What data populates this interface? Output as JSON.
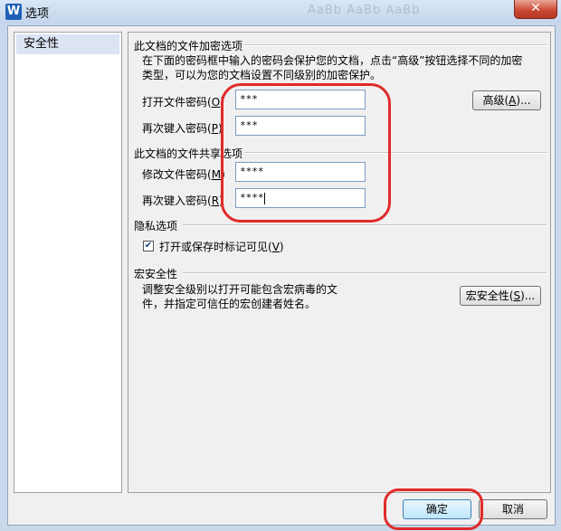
{
  "window": {
    "title": "选项",
    "app_icon": "W",
    "close_glyph": "✕",
    "background_ghost": "AaBb AaBb AaBb"
  },
  "sidebar": {
    "items": [
      {
        "label": "安全性"
      }
    ]
  },
  "encryption": {
    "title": "此文档的文件加密选项",
    "desc_line1": "在下面的密码框中输入的密码会保护您的文档，点击“高级”按钮选择不同的加密",
    "desc_line2": "类型，可以为您的文档设置不同级别的加密保护。",
    "open_pw_label": "打开文件密码",
    "open_pw_key": "O",
    "open_pw_value": "***",
    "confirm_pw_label": "再次键入密码",
    "confirm_pw_key": "P",
    "confirm_pw_value": "***",
    "advanced_label": "高级",
    "advanced_key": "A"
  },
  "sharing": {
    "title": "此文档的文件共享选项",
    "modify_pw_label": "修改文件密码",
    "modify_pw_key": "M",
    "modify_pw_value": "****",
    "confirm_pw_label": "再次键入密码",
    "confirm_pw_key": "R",
    "confirm_pw_value": "****"
  },
  "privacy": {
    "title": "隐私选项",
    "checkbox_label": "打开或保存时标记可见",
    "checkbox_key": "V",
    "checked": true
  },
  "macro": {
    "title": "宏安全性",
    "desc_line1": "调整安全级别以打开可能包含宏病毒的文",
    "desc_line2": "件，并指定可信任的宏创建者姓名。",
    "button_label": "宏安全性",
    "button_key": "S"
  },
  "footer": {
    "ok_label": "确定",
    "cancel_label": "取消"
  },
  "accent_colors": {
    "annotation_red": "#e02a2a",
    "sidebar_selected": "#dce4f3"
  }
}
